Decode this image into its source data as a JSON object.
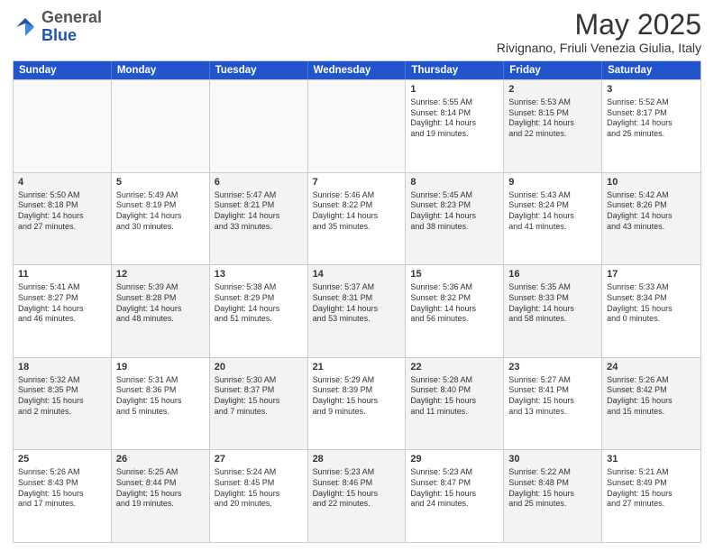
{
  "logo": {
    "general": "General",
    "blue": "Blue"
  },
  "title": "May 2025",
  "location": "Rivignano, Friuli Venezia Giulia, Italy",
  "headers": [
    "Sunday",
    "Monday",
    "Tuesday",
    "Wednesday",
    "Thursday",
    "Friday",
    "Saturday"
  ],
  "weeks": [
    [
      {
        "day": "",
        "info": "",
        "empty": true
      },
      {
        "day": "",
        "info": "",
        "empty": true
      },
      {
        "day": "",
        "info": "",
        "empty": true
      },
      {
        "day": "",
        "info": "",
        "empty": true
      },
      {
        "day": "1",
        "info": "Sunrise: 5:55 AM\nSunset: 8:14 PM\nDaylight: 14 hours\nand 19 minutes."
      },
      {
        "day": "2",
        "info": "Sunrise: 5:53 AM\nSunset: 8:15 PM\nDaylight: 14 hours\nand 22 minutes.",
        "alt": true
      },
      {
        "day": "3",
        "info": "Sunrise: 5:52 AM\nSunset: 8:17 PM\nDaylight: 14 hours\nand 25 minutes."
      }
    ],
    [
      {
        "day": "4",
        "info": "Sunrise: 5:50 AM\nSunset: 8:18 PM\nDaylight: 14 hours\nand 27 minutes.",
        "alt": true
      },
      {
        "day": "5",
        "info": "Sunrise: 5:49 AM\nSunset: 8:19 PM\nDaylight: 14 hours\nand 30 minutes."
      },
      {
        "day": "6",
        "info": "Sunrise: 5:47 AM\nSunset: 8:21 PM\nDaylight: 14 hours\nand 33 minutes.",
        "alt": true
      },
      {
        "day": "7",
        "info": "Sunrise: 5:46 AM\nSunset: 8:22 PM\nDaylight: 14 hours\nand 35 minutes."
      },
      {
        "day": "8",
        "info": "Sunrise: 5:45 AM\nSunset: 8:23 PM\nDaylight: 14 hours\nand 38 minutes.",
        "alt": true
      },
      {
        "day": "9",
        "info": "Sunrise: 5:43 AM\nSunset: 8:24 PM\nDaylight: 14 hours\nand 41 minutes."
      },
      {
        "day": "10",
        "info": "Sunrise: 5:42 AM\nSunset: 8:26 PM\nDaylight: 14 hours\nand 43 minutes.",
        "alt": true
      }
    ],
    [
      {
        "day": "11",
        "info": "Sunrise: 5:41 AM\nSunset: 8:27 PM\nDaylight: 14 hours\nand 46 minutes."
      },
      {
        "day": "12",
        "info": "Sunrise: 5:39 AM\nSunset: 8:28 PM\nDaylight: 14 hours\nand 48 minutes.",
        "alt": true
      },
      {
        "day": "13",
        "info": "Sunrise: 5:38 AM\nSunset: 8:29 PM\nDaylight: 14 hours\nand 51 minutes."
      },
      {
        "day": "14",
        "info": "Sunrise: 5:37 AM\nSunset: 8:31 PM\nDaylight: 14 hours\nand 53 minutes.",
        "alt": true
      },
      {
        "day": "15",
        "info": "Sunrise: 5:36 AM\nSunset: 8:32 PM\nDaylight: 14 hours\nand 56 minutes."
      },
      {
        "day": "16",
        "info": "Sunrise: 5:35 AM\nSunset: 8:33 PM\nDaylight: 14 hours\nand 58 minutes.",
        "alt": true
      },
      {
        "day": "17",
        "info": "Sunrise: 5:33 AM\nSunset: 8:34 PM\nDaylight: 15 hours\nand 0 minutes."
      }
    ],
    [
      {
        "day": "18",
        "info": "Sunrise: 5:32 AM\nSunset: 8:35 PM\nDaylight: 15 hours\nand 2 minutes.",
        "alt": true
      },
      {
        "day": "19",
        "info": "Sunrise: 5:31 AM\nSunset: 8:36 PM\nDaylight: 15 hours\nand 5 minutes."
      },
      {
        "day": "20",
        "info": "Sunrise: 5:30 AM\nSunset: 8:37 PM\nDaylight: 15 hours\nand 7 minutes.",
        "alt": true
      },
      {
        "day": "21",
        "info": "Sunrise: 5:29 AM\nSunset: 8:39 PM\nDaylight: 15 hours\nand 9 minutes."
      },
      {
        "day": "22",
        "info": "Sunrise: 5:28 AM\nSunset: 8:40 PM\nDaylight: 15 hours\nand 11 minutes.",
        "alt": true
      },
      {
        "day": "23",
        "info": "Sunrise: 5:27 AM\nSunset: 8:41 PM\nDaylight: 15 hours\nand 13 minutes."
      },
      {
        "day": "24",
        "info": "Sunrise: 5:26 AM\nSunset: 8:42 PM\nDaylight: 15 hours\nand 15 minutes.",
        "alt": true
      }
    ],
    [
      {
        "day": "25",
        "info": "Sunrise: 5:26 AM\nSunset: 8:43 PM\nDaylight: 15 hours\nand 17 minutes."
      },
      {
        "day": "26",
        "info": "Sunrise: 5:25 AM\nSunset: 8:44 PM\nDaylight: 15 hours\nand 19 minutes.",
        "alt": true
      },
      {
        "day": "27",
        "info": "Sunrise: 5:24 AM\nSunset: 8:45 PM\nDaylight: 15 hours\nand 20 minutes."
      },
      {
        "day": "28",
        "info": "Sunrise: 5:23 AM\nSunset: 8:46 PM\nDaylight: 15 hours\nand 22 minutes.",
        "alt": true
      },
      {
        "day": "29",
        "info": "Sunrise: 5:23 AM\nSunset: 8:47 PM\nDaylight: 15 hours\nand 24 minutes."
      },
      {
        "day": "30",
        "info": "Sunrise: 5:22 AM\nSunset: 8:48 PM\nDaylight: 15 hours\nand 25 minutes.",
        "alt": true
      },
      {
        "day": "31",
        "info": "Sunrise: 5:21 AM\nSunset: 8:49 PM\nDaylight: 15 hours\nand 27 minutes."
      }
    ]
  ]
}
